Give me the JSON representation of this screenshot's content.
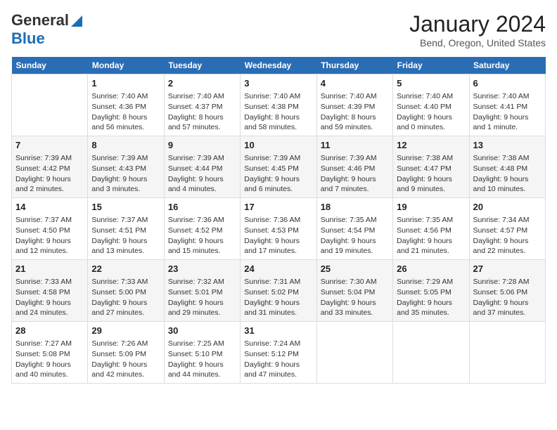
{
  "header": {
    "logo_line1": "General",
    "logo_line2": "Blue",
    "main_title": "January 2024",
    "subtitle": "Bend, Oregon, United States"
  },
  "weekdays": [
    "Sunday",
    "Monday",
    "Tuesday",
    "Wednesday",
    "Thursday",
    "Friday",
    "Saturday"
  ],
  "weeks": [
    [
      {
        "day": "",
        "sunrise": "",
        "sunset": "",
        "daylight": ""
      },
      {
        "day": "1",
        "sunrise": "Sunrise: 7:40 AM",
        "sunset": "Sunset: 4:36 PM",
        "daylight": "Daylight: 8 hours and 56 minutes."
      },
      {
        "day": "2",
        "sunrise": "Sunrise: 7:40 AM",
        "sunset": "Sunset: 4:37 PM",
        "daylight": "Daylight: 8 hours and 57 minutes."
      },
      {
        "day": "3",
        "sunrise": "Sunrise: 7:40 AM",
        "sunset": "Sunset: 4:38 PM",
        "daylight": "Daylight: 8 hours and 58 minutes."
      },
      {
        "day": "4",
        "sunrise": "Sunrise: 7:40 AM",
        "sunset": "Sunset: 4:39 PM",
        "daylight": "Daylight: 8 hours and 59 minutes."
      },
      {
        "day": "5",
        "sunrise": "Sunrise: 7:40 AM",
        "sunset": "Sunset: 4:40 PM",
        "daylight": "Daylight: 9 hours and 0 minutes."
      },
      {
        "day": "6",
        "sunrise": "Sunrise: 7:40 AM",
        "sunset": "Sunset: 4:41 PM",
        "daylight": "Daylight: 9 hours and 1 minute."
      }
    ],
    [
      {
        "day": "7",
        "sunrise": "Sunrise: 7:39 AM",
        "sunset": "Sunset: 4:42 PM",
        "daylight": "Daylight: 9 hours and 2 minutes."
      },
      {
        "day": "8",
        "sunrise": "Sunrise: 7:39 AM",
        "sunset": "Sunset: 4:43 PM",
        "daylight": "Daylight: 9 hours and 3 minutes."
      },
      {
        "day": "9",
        "sunrise": "Sunrise: 7:39 AM",
        "sunset": "Sunset: 4:44 PM",
        "daylight": "Daylight: 9 hours and 4 minutes."
      },
      {
        "day": "10",
        "sunrise": "Sunrise: 7:39 AM",
        "sunset": "Sunset: 4:45 PM",
        "daylight": "Daylight: 9 hours and 6 minutes."
      },
      {
        "day": "11",
        "sunrise": "Sunrise: 7:39 AM",
        "sunset": "Sunset: 4:46 PM",
        "daylight": "Daylight: 9 hours and 7 minutes."
      },
      {
        "day": "12",
        "sunrise": "Sunrise: 7:38 AM",
        "sunset": "Sunset: 4:47 PM",
        "daylight": "Daylight: 9 hours and 9 minutes."
      },
      {
        "day": "13",
        "sunrise": "Sunrise: 7:38 AM",
        "sunset": "Sunset: 4:48 PM",
        "daylight": "Daylight: 9 hours and 10 minutes."
      }
    ],
    [
      {
        "day": "14",
        "sunrise": "Sunrise: 7:37 AM",
        "sunset": "Sunset: 4:50 PM",
        "daylight": "Daylight: 9 hours and 12 minutes."
      },
      {
        "day": "15",
        "sunrise": "Sunrise: 7:37 AM",
        "sunset": "Sunset: 4:51 PM",
        "daylight": "Daylight: 9 hours and 13 minutes."
      },
      {
        "day": "16",
        "sunrise": "Sunrise: 7:36 AM",
        "sunset": "Sunset: 4:52 PM",
        "daylight": "Daylight: 9 hours and 15 minutes."
      },
      {
        "day": "17",
        "sunrise": "Sunrise: 7:36 AM",
        "sunset": "Sunset: 4:53 PM",
        "daylight": "Daylight: 9 hours and 17 minutes."
      },
      {
        "day": "18",
        "sunrise": "Sunrise: 7:35 AM",
        "sunset": "Sunset: 4:54 PM",
        "daylight": "Daylight: 9 hours and 19 minutes."
      },
      {
        "day": "19",
        "sunrise": "Sunrise: 7:35 AM",
        "sunset": "Sunset: 4:56 PM",
        "daylight": "Daylight: 9 hours and 21 minutes."
      },
      {
        "day": "20",
        "sunrise": "Sunrise: 7:34 AM",
        "sunset": "Sunset: 4:57 PM",
        "daylight": "Daylight: 9 hours and 22 minutes."
      }
    ],
    [
      {
        "day": "21",
        "sunrise": "Sunrise: 7:33 AM",
        "sunset": "Sunset: 4:58 PM",
        "daylight": "Daylight: 9 hours and 24 minutes."
      },
      {
        "day": "22",
        "sunrise": "Sunrise: 7:33 AM",
        "sunset": "Sunset: 5:00 PM",
        "daylight": "Daylight: 9 hours and 27 minutes."
      },
      {
        "day": "23",
        "sunrise": "Sunrise: 7:32 AM",
        "sunset": "Sunset: 5:01 PM",
        "daylight": "Daylight: 9 hours and 29 minutes."
      },
      {
        "day": "24",
        "sunrise": "Sunrise: 7:31 AM",
        "sunset": "Sunset: 5:02 PM",
        "daylight": "Daylight: 9 hours and 31 minutes."
      },
      {
        "day": "25",
        "sunrise": "Sunrise: 7:30 AM",
        "sunset": "Sunset: 5:04 PM",
        "daylight": "Daylight: 9 hours and 33 minutes."
      },
      {
        "day": "26",
        "sunrise": "Sunrise: 7:29 AM",
        "sunset": "Sunset: 5:05 PM",
        "daylight": "Daylight: 9 hours and 35 minutes."
      },
      {
        "day": "27",
        "sunrise": "Sunrise: 7:28 AM",
        "sunset": "Sunset: 5:06 PM",
        "daylight": "Daylight: 9 hours and 37 minutes."
      }
    ],
    [
      {
        "day": "28",
        "sunrise": "Sunrise: 7:27 AM",
        "sunset": "Sunset: 5:08 PM",
        "daylight": "Daylight: 9 hours and 40 minutes."
      },
      {
        "day": "29",
        "sunrise": "Sunrise: 7:26 AM",
        "sunset": "Sunset: 5:09 PM",
        "daylight": "Daylight: 9 hours and 42 minutes."
      },
      {
        "day": "30",
        "sunrise": "Sunrise: 7:25 AM",
        "sunset": "Sunset: 5:10 PM",
        "daylight": "Daylight: 9 hours and 44 minutes."
      },
      {
        "day": "31",
        "sunrise": "Sunrise: 7:24 AM",
        "sunset": "Sunset: 5:12 PM",
        "daylight": "Daylight: 9 hours and 47 minutes."
      },
      {
        "day": "",
        "sunrise": "",
        "sunset": "",
        "daylight": ""
      },
      {
        "day": "",
        "sunrise": "",
        "sunset": "",
        "daylight": ""
      },
      {
        "day": "",
        "sunrise": "",
        "sunset": "",
        "daylight": ""
      }
    ]
  ]
}
